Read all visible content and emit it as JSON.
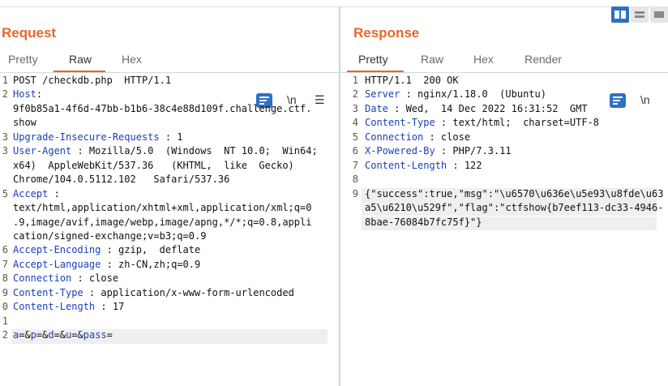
{
  "request": {
    "title": "Request",
    "tabs": [
      {
        "label": "Pretty",
        "active": false
      },
      {
        "label": "Raw",
        "active": true
      },
      {
        "label": "Hex",
        "active": false
      }
    ],
    "tools": {
      "wrap": "wrap-icon",
      "newline": "\\n",
      "menu": "☰"
    },
    "lines": [
      {
        "n": "1",
        "parts": [
          {
            "t": "POST /checkdb.php  HTTP/1.1",
            "c": "plain"
          }
        ]
      },
      {
        "n": "2",
        "parts": [
          {
            "t": "Host",
            "c": "hdr"
          },
          {
            "t": ":",
            "c": "plain"
          }
        ]
      },
      {
        "n": "",
        "parts": [
          {
            "t": "9f0b85a1-4f6d-47bb-b1b6-38c4e88d109f.challenge.ctf.",
            "c": "plain"
          }
        ]
      },
      {
        "n": "",
        "parts": [
          {
            "t": "show",
            "c": "plain"
          }
        ]
      },
      {
        "n": "3",
        "parts": [
          {
            "t": "Upgrade-Insecure-Requests",
            "c": "hdr"
          },
          {
            "t": " : 1",
            "c": "plain"
          }
        ]
      },
      {
        "n": "3",
        "parts": [
          {
            "t": "User-Agent",
            "c": "hdr"
          },
          {
            "t": " : Mozilla/5.0  (Windows  NT 10.0;  Win64;",
            "c": "plain"
          }
        ]
      },
      {
        "n": "",
        "parts": [
          {
            "t": "x64)  AppleWebKit/537.36   (KHTML,  like  Gecko)",
            "c": "plain"
          }
        ]
      },
      {
        "n": "",
        "parts": [
          {
            "t": "Chrome/104.0.5112.102   Safari/537.36",
            "c": "plain"
          }
        ]
      },
      {
        "n": "5",
        "parts": [
          {
            "t": "Accept",
            "c": "hdr"
          },
          {
            "t": " :",
            "c": "plain"
          }
        ]
      },
      {
        "n": "",
        "parts": [
          {
            "t": "text/html,application/xhtml+xml,application/xml;q=0",
            "c": "plain"
          }
        ]
      },
      {
        "n": "",
        "parts": [
          {
            "t": ".9,image/avif,image/webp,image/apng,*/*;q=0.8,appli",
            "c": "plain"
          }
        ]
      },
      {
        "n": "",
        "parts": [
          {
            "t": "cation/signed-exchange;v=b3;q=0.9",
            "c": "plain"
          }
        ]
      },
      {
        "n": "6",
        "parts": [
          {
            "t": "Accept-Encoding",
            "c": "hdr"
          },
          {
            "t": " : gzip,  deflate",
            "c": "plain"
          }
        ]
      },
      {
        "n": "7",
        "parts": [
          {
            "t": "Accept-Language",
            "c": "hdr"
          },
          {
            "t": " : zh-CN,zh;q=0.9",
            "c": "plain"
          }
        ]
      },
      {
        "n": "8",
        "parts": [
          {
            "t": "Connection",
            "c": "hdr"
          },
          {
            "t": " : close",
            "c": "plain"
          }
        ]
      },
      {
        "n": "9",
        "parts": [
          {
            "t": "Content-Type",
            "c": "hdr"
          },
          {
            "t": " : application/x-www-form-urlencoded",
            "c": "plain"
          }
        ]
      },
      {
        "n": "0",
        "parts": [
          {
            "t": "Content-Length",
            "c": "hdr"
          },
          {
            "t": " : 17",
            "c": "plain"
          }
        ]
      },
      {
        "n": "1",
        "parts": [
          {
            "t": "",
            "c": "plain"
          }
        ]
      },
      {
        "n": "2",
        "parts": [
          {
            "t": "a",
            "c": "hdr"
          },
          {
            "t": "=&",
            "c": "plain"
          },
          {
            "t": "p",
            "c": "hdr"
          },
          {
            "t": "=&",
            "c": "plain"
          },
          {
            "t": "d",
            "c": "hdr"
          },
          {
            "t": "=&",
            "c": "plain"
          },
          {
            "t": "u",
            "c": "hdr"
          },
          {
            "t": "=&",
            "c": "plain"
          },
          {
            "t": "pass",
            "c": "hdr"
          },
          {
            "t": "=",
            "c": "plain"
          }
        ],
        "highlight": true
      }
    ]
  },
  "response": {
    "title": "Response",
    "tabs": [
      {
        "label": "Pretty",
        "active": true
      },
      {
        "label": "Raw",
        "active": false
      },
      {
        "label": "Hex",
        "active": false
      },
      {
        "label": "Render",
        "active": false
      }
    ],
    "tools": {
      "wrap": "wrap-icon",
      "newline": "\\n"
    },
    "lines": [
      {
        "n": "1",
        "parts": [
          {
            "t": "HTTP/1.1  200 OK",
            "c": "plain"
          }
        ]
      },
      {
        "n": "2",
        "parts": [
          {
            "t": "Server",
            "c": "hdr"
          },
          {
            "t": " : nginx/1.18.0  (Ubuntu)",
            "c": "plain"
          }
        ]
      },
      {
        "n": "3",
        "parts": [
          {
            "t": "Date",
            "c": "hdr"
          },
          {
            "t": " : Wed,  14 Dec 2022 16:31:52  GMT",
            "c": "plain"
          }
        ]
      },
      {
        "n": "4",
        "parts": [
          {
            "t": "Content-Type",
            "c": "hdr"
          },
          {
            "t": " : text/html;  charset=UTF-8",
            "c": "plain"
          }
        ]
      },
      {
        "n": "5",
        "parts": [
          {
            "t": "Connection",
            "c": "hdr"
          },
          {
            "t": " : close",
            "c": "plain"
          }
        ]
      },
      {
        "n": "6",
        "parts": [
          {
            "t": "X-Powered-By",
            "c": "hdr"
          },
          {
            "t": " : PHP/7.3.11",
            "c": "plain"
          }
        ]
      },
      {
        "n": "7",
        "parts": [
          {
            "t": "Content-Length",
            "c": "hdr"
          },
          {
            "t": " : 122",
            "c": "plain"
          }
        ]
      },
      {
        "n": "8",
        "parts": [
          {
            "t": "",
            "c": "plain"
          }
        ]
      },
      {
        "n": "9",
        "parts": [
          {
            "t": "{\"success\":true,\"msg\":\"\\u6570\\u636e\\u5e93\\u8fde\\u63",
            "c": "plain"
          }
        ],
        "highlight": true
      },
      {
        "n": "",
        "parts": [
          {
            "t": "a5\\u6210\\u529f\",\"flag\":\"ctfshow{b7eef113-dc33-4946-",
            "c": "plain"
          }
        ],
        "highlight": true
      },
      {
        "n": "",
        "parts": [
          {
            "t": "8bae-76084b7fc75f}\"}",
            "c": "plain"
          }
        ],
        "highlight": true
      }
    ]
  },
  "colors": {
    "accent": "#e8662c",
    "header_key": "#1a3fb5",
    "button_blue": "#2f6fc6"
  }
}
